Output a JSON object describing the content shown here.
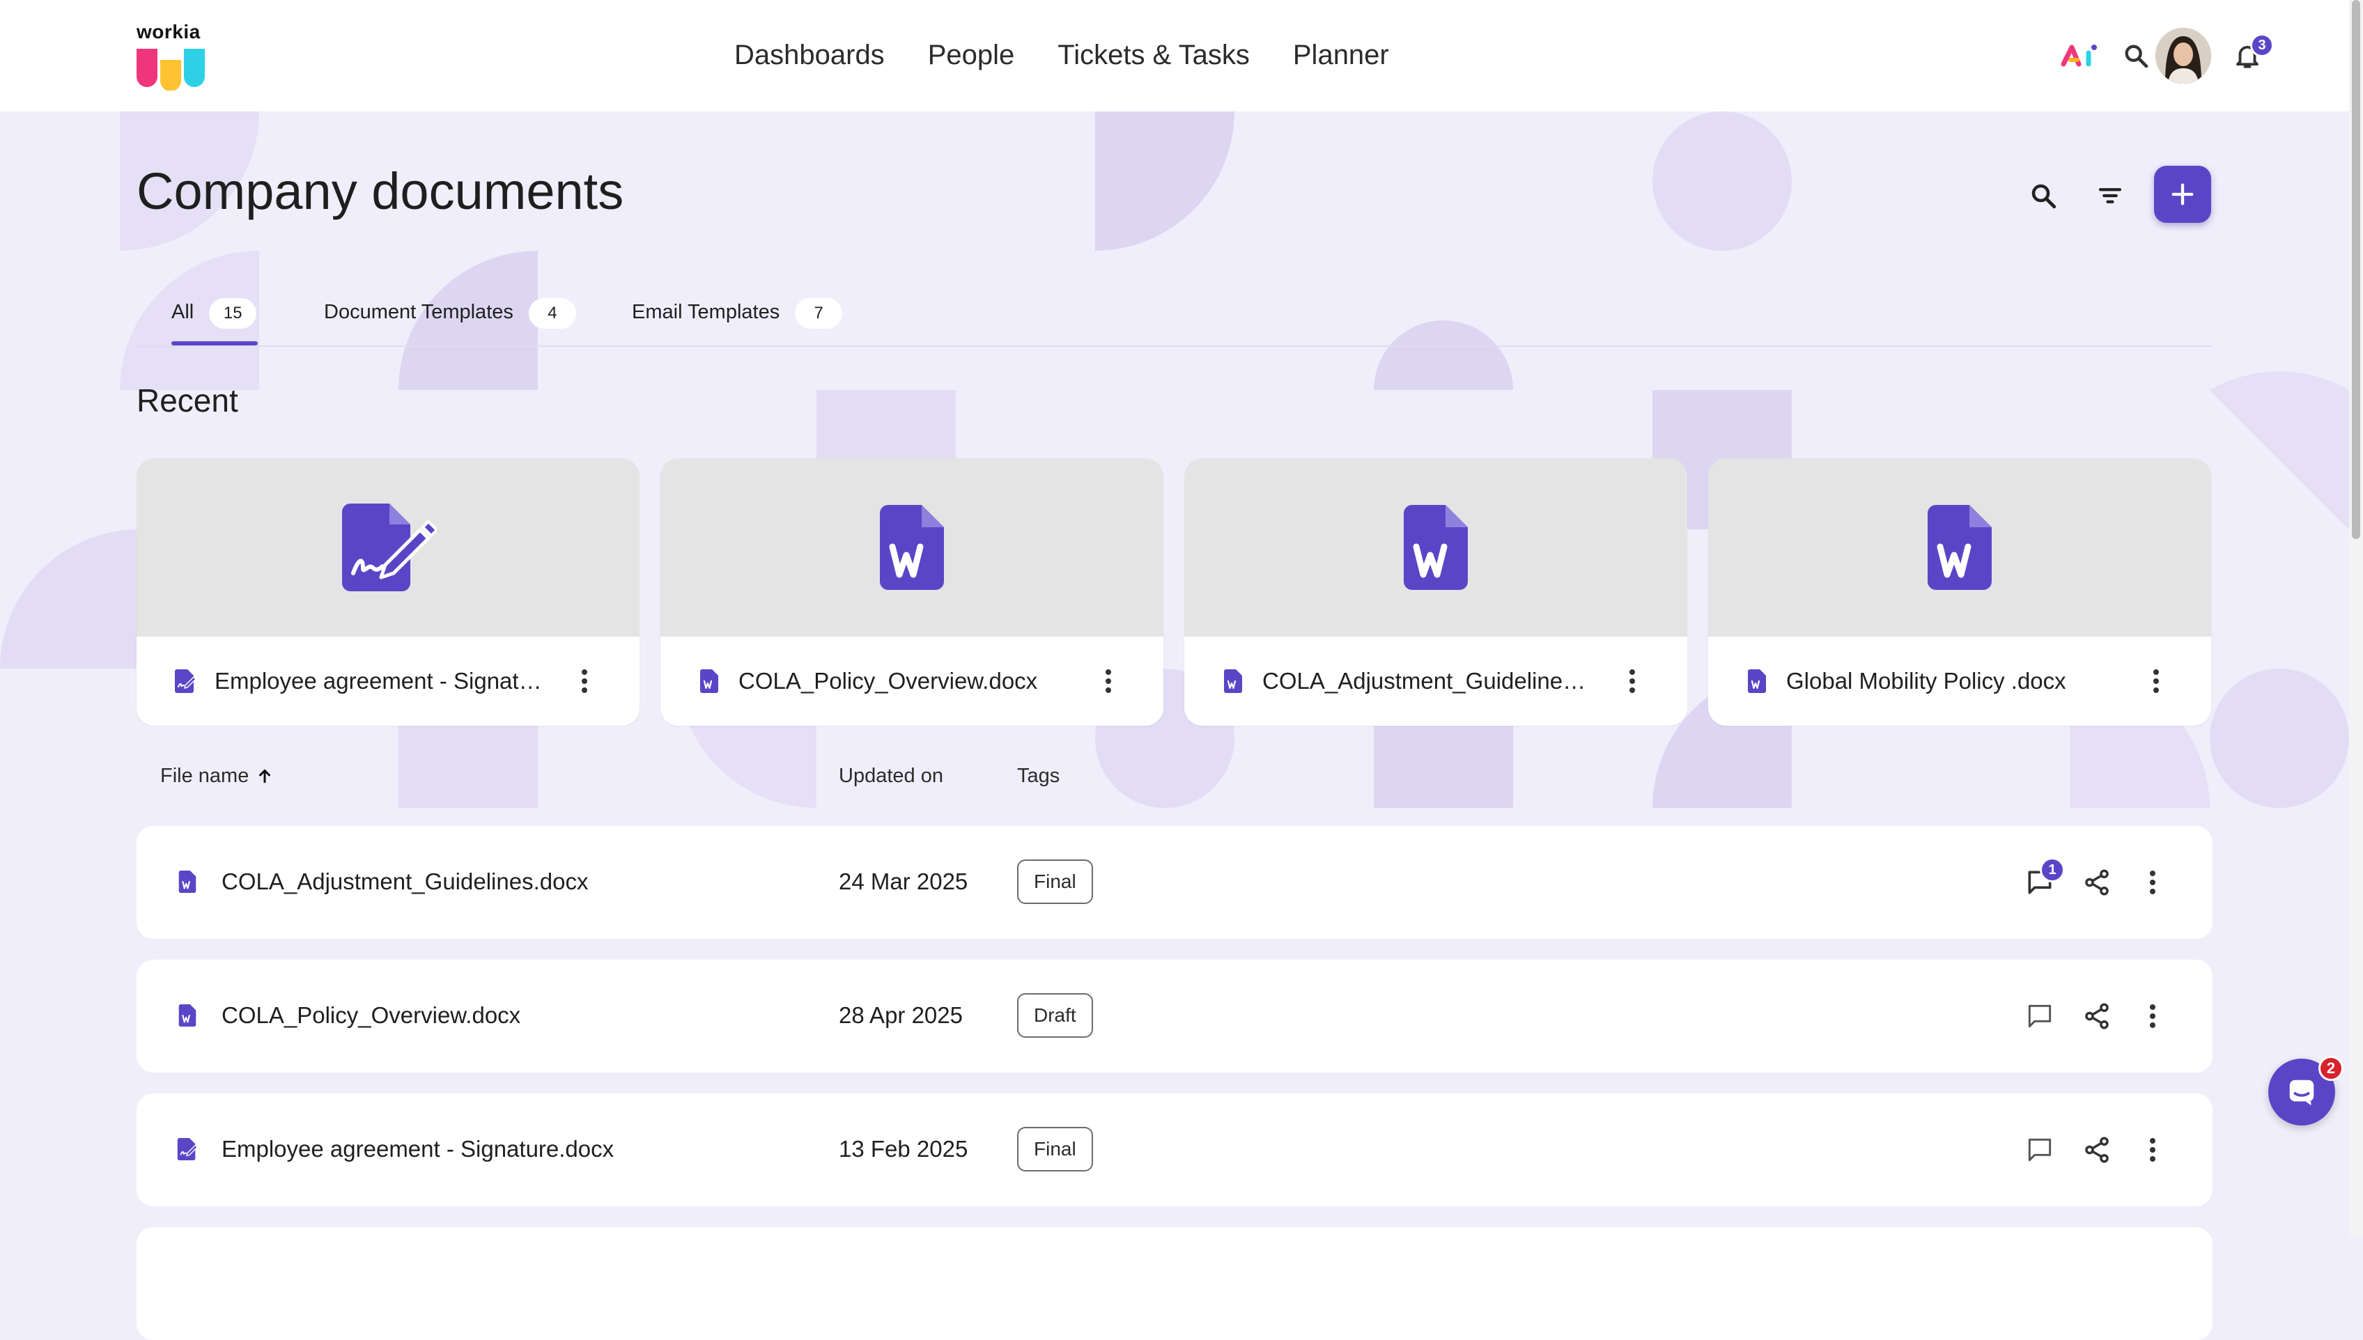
{
  "app": {
    "logo_text": "workia",
    "nav": [
      "Dashboards",
      "People",
      "Tickets & Tasks",
      "Planner"
    ],
    "notifications_count": "3",
    "accent_color": "#5b45c7"
  },
  "header_icons": [
    "ai-icon",
    "search-icon",
    "translate-icon",
    "bell-icon",
    "avatar"
  ],
  "page": {
    "title": "Company documents",
    "tabs": [
      {
        "label": "All",
        "count": "15",
        "active": true
      },
      {
        "label": "Document Templates",
        "count": "4"
      },
      {
        "label": "Email Templates",
        "count": "7"
      }
    ],
    "recent_title": "Recent"
  },
  "recent": [
    {
      "name": "Employee agreement - Signatu...",
      "icon": "signature-doc-icon"
    },
    {
      "name": "COLA_Policy_Overview.docx",
      "icon": "word-doc-icon"
    },
    {
      "name": "COLA_Adjustment_Guidelines....",
      "icon": "word-doc-icon"
    },
    {
      "name": "Global Mobility Policy .docx",
      "icon": "word-doc-icon"
    }
  ],
  "table": {
    "columns": {
      "file_name": "File name",
      "updated_on": "Updated on",
      "tags": "Tags"
    },
    "sort_icon": "arrow-up-icon",
    "rows": [
      {
        "name": "COLA_Adjustment_Guidelines.docx",
        "date": "24 Mar 2025",
        "tag": "Final",
        "comments": "1",
        "icon": "word-doc-icon"
      },
      {
        "name": "COLA_Policy_Overview.docx",
        "date": "28 Apr 2025",
        "tag": "Draft",
        "comments": "",
        "icon": "word-doc-icon"
      },
      {
        "name": "Employee agreement - Signature.docx",
        "date": "13 Feb 2025",
        "tag": "Final",
        "comments": "",
        "icon": "signature-doc-icon"
      }
    ]
  },
  "chat": {
    "unread": "2"
  }
}
